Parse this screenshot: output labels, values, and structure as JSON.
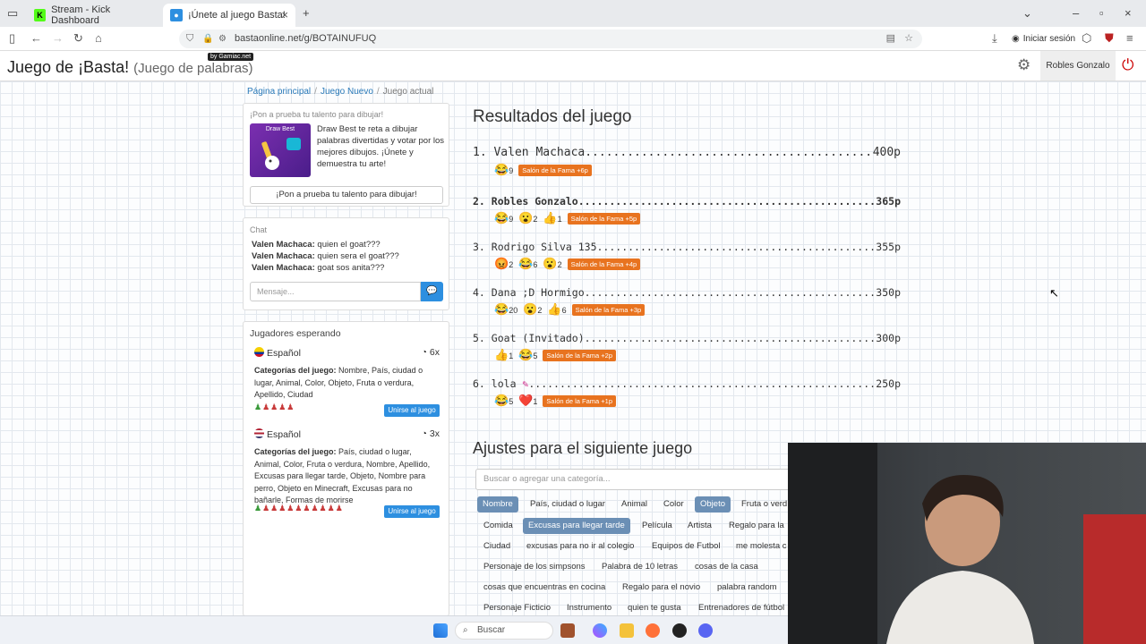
{
  "browser": {
    "tabs": [
      {
        "title": "Stream - Kick Dashboard",
        "icon": "kick-icon"
      },
      {
        "title": "¡Únete al juego Basta!",
        "icon": "basta-icon"
      }
    ],
    "url": "bastaonline.net/g/BOTAINUFUQ",
    "login_label": "Iniciar sesión"
  },
  "header": {
    "title": "Juego de ¡Basta!",
    "subtitle": "(Juego de palabras)",
    "badge": "by Gamiac.net",
    "username": "Robles Gonzalo"
  },
  "breadcrumb": {
    "home": "Página principal",
    "new_game": "Juego Nuevo",
    "current": "Juego actual"
  },
  "promo": {
    "title": "¡Pon a prueba tu talento para dibujar!",
    "image_label": "Draw Best",
    "text": "Draw Best te reta a dibujar palabras divertidas y votar por los mejores dibujos. ¡Únete y demuestra tu arte!",
    "button": "¡Pon a prueba tu talento para dibujar!"
  },
  "chat": {
    "title": "Chat",
    "messages": [
      {
        "user": "Valen Machaca:",
        "text": "quien el goat???"
      },
      {
        "user": "Valen Machaca:",
        "text": "quien sera el goat???"
      },
      {
        "user": "Valen Machaca:",
        "text": "goat sos anita???"
      }
    ],
    "placeholder": "Mensaje..."
  },
  "waiting": {
    "title": "Jugadores esperando",
    "games": [
      {
        "language": "Español",
        "count": "6x",
        "categories_label": "Categorías del juego:",
        "categories": "Nombre, País, ciudad o lugar, Animal, Color, Objeto, Fruta o verdura, Apellido, Ciudad",
        "players": "g,r,r,r,r",
        "join": "Unirse al juego"
      },
      {
        "language": "Español",
        "count": "3x",
        "categories_label": "Categorías del juego:",
        "categories": "País, ciudad o lugar, Animal, Color, Fruta o verdura, Nombre, Apellido, Excusas para llegar tarde, Objeto, Nombre para perro, Objeto en Minecraft, Excusas para no bañarle, Formas de morirse",
        "players": "g,r,r,r,r,r,r,r,r,r,r",
        "join": "Unirse al juego"
      }
    ]
  },
  "results": {
    "title": "Resultados del juego",
    "rows": [
      {
        "rank": "1.",
        "name": "Valen Machaca",
        "points": "400p",
        "reactions": [
          {
            "emoji": "😂",
            "count": "9"
          }
        ],
        "fame": "Salón de la Fama +6p"
      },
      {
        "rank": "2.",
        "name": "Robles Gonzalo",
        "points": "365p",
        "reactions": [
          {
            "emoji": "😂",
            "count": "9"
          },
          {
            "emoji": "😮",
            "count": "2"
          },
          {
            "emoji": "👍",
            "count": "1"
          }
        ],
        "fame": "Salón de la Fama +5p"
      },
      {
        "rank": "3.",
        "name": "Rodrigo Silva 135",
        "points": "355p",
        "reactions": [
          {
            "emoji": "😡",
            "count": "2"
          },
          {
            "emoji": "😂",
            "count": "6"
          },
          {
            "emoji": "😮",
            "count": "2"
          }
        ],
        "fame": "Salón de la Fama +4p"
      },
      {
        "rank": "4.",
        "name": "Dana ;D Hormigo",
        "points": "350p",
        "reactions": [
          {
            "emoji": "😂",
            "count": "20"
          },
          {
            "emoji": "😮",
            "count": "2"
          },
          {
            "emoji": "👍",
            "count": "6"
          }
        ],
        "fame": "Salón de la Fama +3p"
      },
      {
        "rank": "5.",
        "name": "Goat (Invitado)",
        "points": "300p",
        "reactions": [
          {
            "emoji": "👍",
            "count": "1"
          },
          {
            "emoji": "😂",
            "count": "5"
          }
        ],
        "fame": "Salón de la Fama +2p"
      },
      {
        "rank": "6.",
        "name": "lola",
        "points": "250p",
        "reactions": [
          {
            "emoji": "😂",
            "count": "5"
          },
          {
            "emoji": "❤️",
            "count": "1"
          }
        ],
        "fame": "Salón de la Fama +1p"
      }
    ]
  },
  "settings": {
    "title": "Ajustes para el siguiente juego",
    "search_placeholder": "Buscar o agregar una categoría...",
    "categories": [
      {
        "label": "Nombre",
        "on": true
      },
      {
        "label": "País, ciudad o lugar",
        "on": false
      },
      {
        "label": "Animal",
        "on": false
      },
      {
        "label": "Color",
        "on": false
      },
      {
        "label": "Objeto",
        "on": true
      },
      {
        "label": "Fruta o verd",
        "on": false
      },
      {
        "label": "Comida",
        "on": false
      },
      {
        "label": "Excusas para llegar tarde",
        "on": true
      },
      {
        "label": "Película",
        "on": false
      },
      {
        "label": "Artista",
        "on": false
      },
      {
        "label": "Regalo para la",
        "on": false
      },
      {
        "label": "Ciudad",
        "on": false
      },
      {
        "label": "excusas para no ir al colegio",
        "on": false
      },
      {
        "label": "Equipos de Futbol",
        "on": false
      },
      {
        "label": "me molesta c",
        "on": false
      },
      {
        "label": "Personaje de los simpsons",
        "on": false
      },
      {
        "label": "Palabra de 10 letras",
        "on": false
      },
      {
        "label": "cosas de la casa",
        "on": false
      },
      {
        "label": "cosas que encuentras en cocina",
        "on": false
      },
      {
        "label": "Regalo para el novio",
        "on": false
      },
      {
        "label": "palabra random",
        "on": false
      },
      {
        "label": "Personaje Ficticio",
        "on": false
      },
      {
        "label": "Instrumento",
        "on": false
      },
      {
        "label": "quien te gusta",
        "on": false
      },
      {
        "label": "Entrenadores de fútbol",
        "on": false
      }
    ]
  },
  "taskbar": {
    "search_label": "Buscar"
  },
  "colors": {
    "accent": "#2d8fe0",
    "fame": "#e8731f",
    "selected_category": "#6b8fb5"
  }
}
